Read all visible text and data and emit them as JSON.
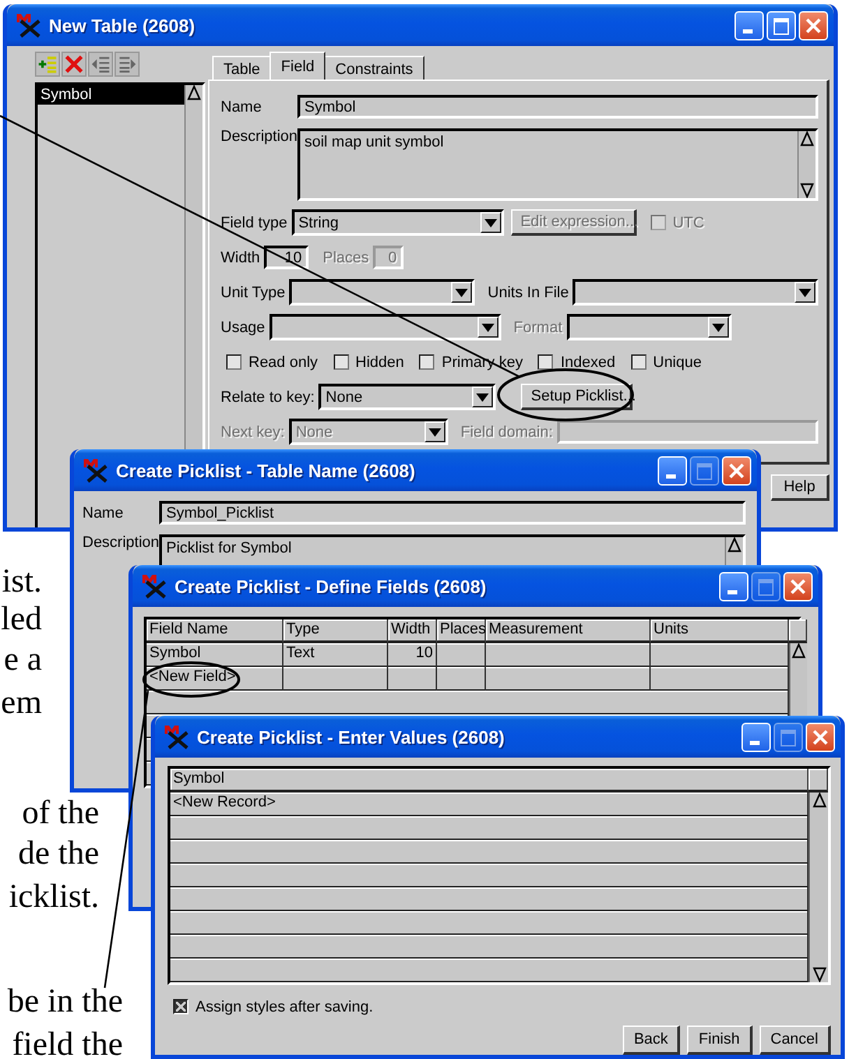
{
  "new_table_window": {
    "title": "New Table (2608)",
    "maximize_disabled": false,
    "field_list": [
      {
        "label": "Symbol",
        "selected": true
      }
    ],
    "tabs": [
      {
        "label": "Table",
        "selected": false
      },
      {
        "label": "Field",
        "selected": true
      },
      {
        "label": "Constraints",
        "selected": false
      }
    ],
    "name": {
      "label": "Name",
      "value": "Symbol"
    },
    "description": {
      "label": "Description",
      "value": "soil map unit symbol"
    },
    "field_type": {
      "label": "Field type",
      "value": "String"
    },
    "edit_expression_button": {
      "label": "Edit expression...",
      "disabled": true
    },
    "utc": {
      "label": "UTC",
      "checked": false,
      "disabled": true
    },
    "width": {
      "label": "Width",
      "value": "10"
    },
    "places": {
      "label": "Places",
      "value": "0",
      "disabled": true
    },
    "unit_type": {
      "label": "Unit Type"
    },
    "units_in_file": {
      "label": "Units In File"
    },
    "usage": {
      "label": "Usage"
    },
    "format": {
      "label": "Format",
      "disabled": true
    },
    "flags": [
      {
        "label": "Read only",
        "checked": false
      },
      {
        "label": "Hidden",
        "checked": false
      },
      {
        "label": "Primary key",
        "checked": false
      },
      {
        "label": "Indexed",
        "checked": false
      },
      {
        "label": "Unique",
        "checked": false
      }
    ],
    "relate_to_key": {
      "label": "Relate to key:",
      "value": "None"
    },
    "setup_picklist_button": "Setup Picklist...",
    "next_key": {
      "label": "Next key:",
      "value": "None",
      "disabled": true
    },
    "field_domain": {
      "label": "Field domain:",
      "disabled": true
    },
    "help_button": "Help"
  },
  "table_name_window": {
    "title": "Create Picklist - Table Name (2608)",
    "maximize_disabled": true,
    "name": {
      "label": "Name",
      "value": "Symbol_Picklist"
    },
    "description": {
      "label": "Description",
      "value": "Picklist for Symbol"
    }
  },
  "define_fields_window": {
    "title": "Create Picklist - Define Fields (2608)",
    "maximize_disabled": true,
    "columns": [
      {
        "label": "Field Name",
        "kind": "text"
      },
      {
        "label": "Type",
        "kind": "text"
      },
      {
        "label": "Width",
        "kind": "number"
      },
      {
        "label": "Places"
      },
      {
        "label": "Measurement"
      },
      {
        "label": "Units"
      }
    ],
    "rows": [
      {
        "cells": [
          "Symbol",
          "Text",
          "10"
        ]
      },
      {
        "cells": [
          "<New Field>"
        ]
      }
    ]
  },
  "enter_values_window": {
    "title": "Create Picklist - Enter Values (2608)",
    "maximize_disabled": true,
    "columns": [
      {
        "label": "Symbol"
      }
    ],
    "rows": [
      {
        "cells": [
          "<New Record>"
        ]
      }
    ],
    "assign_styles": {
      "label": "Assign styles after saving.",
      "checked": true
    },
    "buttons": [
      "Back",
      "Finish",
      "Cancel"
    ]
  },
  "page_text_fragments": [
    {
      "text": "ist."
    },
    {
      "text": "led"
    },
    {
      "text": "e a"
    },
    {
      "text": "em"
    },
    {
      "text": "of the"
    },
    {
      "text": "de the"
    },
    {
      "text": "icklist."
    },
    {
      "text": "be in the"
    },
    {
      "text": "field the"
    }
  ]
}
